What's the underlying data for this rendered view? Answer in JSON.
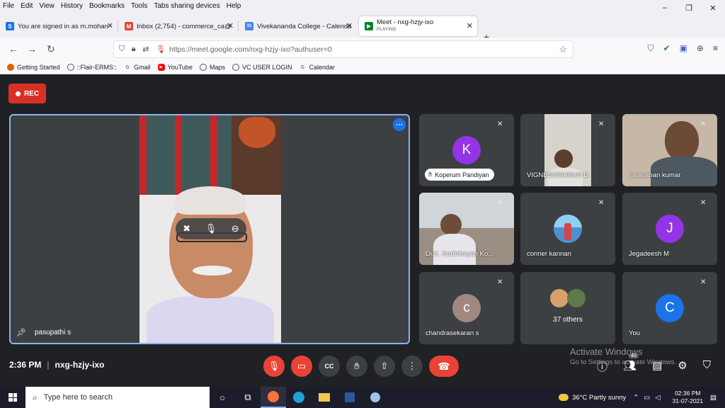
{
  "menu": [
    "File",
    "Edit",
    "View",
    "History",
    "Bookmarks",
    "Tools",
    "Tabs sharing devices",
    "Help"
  ],
  "window_controls": {
    "minimize": "–",
    "restore": "❐",
    "close": "✕"
  },
  "tabs": [
    {
      "title": "You are signed in as m.mohan",
      "icon_letter": "S",
      "icon_color": "#1a73e8"
    },
    {
      "title": "Inbox (2,754) - commerce_ca@",
      "icon_letter": "M",
      "icon_color": "#ea4335"
    },
    {
      "title": "Vivekananda College - Calenda",
      "icon_letter": "31",
      "icon_color": "#4285f4"
    },
    {
      "title": "Meet - nxg-hzjy-ixo",
      "subtitle": "PLAYING",
      "icon_letter": "▶",
      "icon_color": "#00832d"
    }
  ],
  "url": "https://meet.google.com/nxg-hzjy-ixo?authuser=0",
  "bookmarks": [
    {
      "label": "Getting Started",
      "color": "#e66000",
      "letter": ""
    },
    {
      "label": "::Flair-ERMS::",
      "color": "#555555",
      "letter": ""
    },
    {
      "label": "Gmail",
      "color": "#4285f4",
      "letter": "G"
    },
    {
      "label": "YouTube",
      "color": "#ff0000",
      "letter": "▶"
    },
    {
      "label": "Maps",
      "color": "#555555",
      "letter": ""
    },
    {
      "label": "VC USER LOGIN",
      "color": "#555555",
      "letter": ""
    },
    {
      "label": "Calendar",
      "color": "#4285f4",
      "letter": "G"
    }
  ],
  "meet": {
    "rec_label": "REC",
    "main_speaker": "pasupathi s",
    "time": "2:36 PM",
    "meeting_code": "nxg-hzjy-ixo",
    "participant_count": "40",
    "watermark_title": "Activate Windows",
    "watermark_sub": "Go to Settings to activate Windows.",
    "tiles": [
      {
        "name": "Koperum Pandiyan",
        "letter": "K",
        "color": "#9334e6",
        "kind": "avatar-pill"
      },
      {
        "name": "VIGNESHWARAN D",
        "kind": "video",
        "bg": "#b8b4a8"
      },
      {
        "name": "saravanan kumar",
        "kind": "video",
        "bg": "#c6b7a6"
      },
      {
        "name": "Dr.K. Karthikeyan Ko...",
        "kind": "video",
        "bg": "#9b8f84"
      },
      {
        "name": "conner kannan",
        "kind": "photo",
        "color": "#4d8fd1"
      },
      {
        "name": "Jegadeesh M",
        "letter": "J",
        "color": "#9334e6",
        "kind": "avatar"
      },
      {
        "name": "chandrasekaran s",
        "letter": "c",
        "color": "#a1887f",
        "kind": "avatar"
      },
      {
        "name": "37 others",
        "kind": "others"
      },
      {
        "name": "You",
        "letter": "C",
        "color": "#1a73e8",
        "kind": "avatar"
      }
    ]
  },
  "taskbar": {
    "search_placeholder": "Type here to search",
    "weather": "36°C  Partly sunny",
    "time": "02:36 PM",
    "date": "31-07-2021"
  }
}
